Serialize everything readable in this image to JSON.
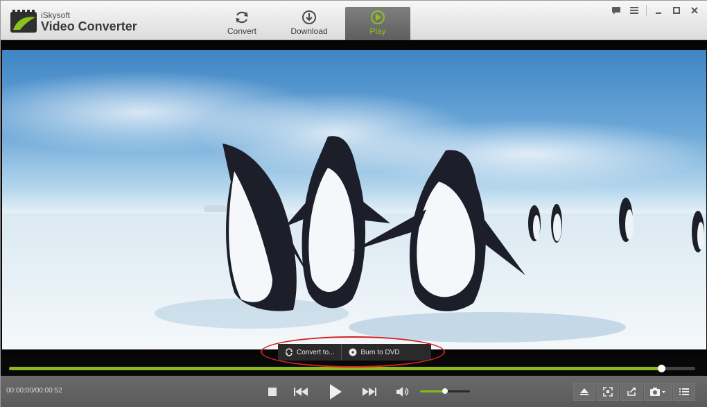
{
  "app": {
    "brand_small": "iSkysoft",
    "brand_name": "Video Converter"
  },
  "tabs": [
    {
      "label": "Convert",
      "icon": "refresh-icon",
      "active": false
    },
    {
      "label": "Download",
      "icon": "download-icon",
      "active": false
    },
    {
      "label": "Play",
      "icon": "play-circle-icon",
      "active": true
    }
  ],
  "window_controls": [
    "feedback-icon",
    "menu-icon",
    "minimize-icon",
    "maximize-icon",
    "close-icon"
  ],
  "overlay_actions": [
    {
      "label": "Convert to...",
      "icon": "refresh-icon"
    },
    {
      "label": "Burn to DVD",
      "icon": "disc-icon"
    }
  ],
  "playback": {
    "time": "00:00:00/00:00:52",
    "progress": 0.95,
    "volume": 0.5
  },
  "colors": {
    "accent": "#8ab91b",
    "highlight_ring": "#d42020"
  },
  "toolbar": [
    "eject-icon",
    "fullscreen-icon",
    "share-icon",
    "camera-icon",
    "playlist-icon"
  ]
}
